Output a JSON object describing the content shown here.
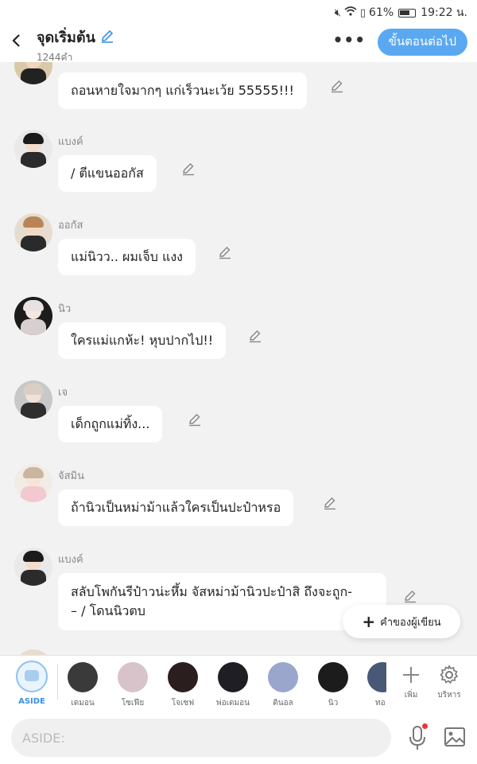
{
  "status_bar": {
    "battery": "61%",
    "time": "19:22 น."
  },
  "header": {
    "title": "จุดเริ่มต้น",
    "word_count": "1244คำ",
    "more": "•••",
    "next_button": "ขั้นตอนต่อไป"
  },
  "messages": [
    {
      "speaker": "",
      "text": "ถอนหายใจมากๆ แก่เร็วนะเว้ย 55555!!!"
    },
    {
      "speaker": "แบงค์",
      "text": "/ ตีแขนออกัส"
    },
    {
      "speaker": "ออกัส",
      "text": "แม่นิวว.. ผมเจ็บ แงง"
    },
    {
      "speaker": "นิว",
      "text": "ใครแม่แกห้ะ! หุบปากไป!!"
    },
    {
      "speaker": "เจ",
      "text": "เด็กถูกแม่ทิ้ง..."
    },
    {
      "speaker": "จัสมิน",
      "text": "ถ้านิวเป็นหม่าม้าแล้วใครเป็นปะป๋าหรอ"
    },
    {
      "speaker": "แบงค์",
      "text_line1": "สลับโพกันรีป๋าวน่ะหึ้ม จัสหม่าม้านิวปะป๋าสิ ถึงจะถูก-",
      "text_line2": "– / โดนนิวตบ"
    }
  ],
  "author_note_button": "คำของผู้เขียน",
  "character_bar": {
    "aside_label": "ASIDE",
    "characters": [
      "เดมอน",
      "โซเฟีย",
      "โจเซฟ",
      "พ่อเดมอน",
      "ดินอล",
      "นิว",
      "ทอ"
    ],
    "add_label": "เพิ่ม",
    "manage_label": "บริหาร"
  },
  "input": {
    "placeholder": "ASIDE:"
  },
  "colors": {
    "accent": "#5aa8f2",
    "background": "#f2f2f2",
    "bubble": "#ffffff"
  }
}
